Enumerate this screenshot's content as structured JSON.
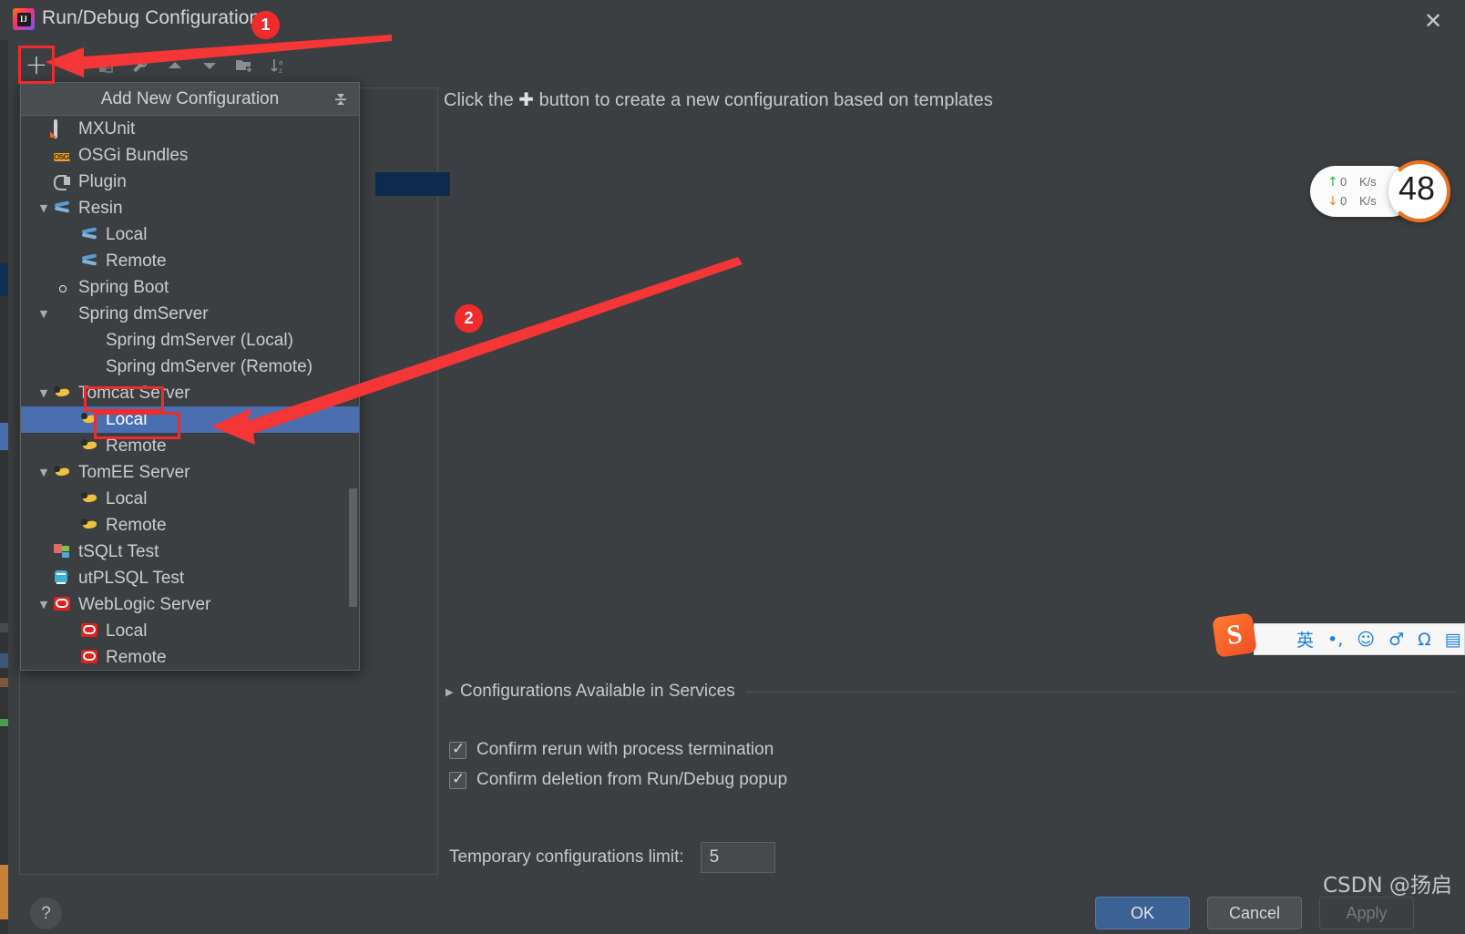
{
  "window": {
    "title": "Run/Debug Configurations",
    "app_icon": "intellij-idea-logo",
    "close_icon": "close-icon"
  },
  "toolbar": {
    "buttons": [
      {
        "name": "add-configuration-button",
        "icon": "plus-icon",
        "label": "+"
      },
      {
        "name": "remove-configuration-button",
        "icon": "minus-icon",
        "label": "−"
      },
      {
        "name": "copy-configuration-button",
        "icon": "copy-icon",
        "label": ""
      },
      {
        "name": "edit-templates-button",
        "icon": "wrench-icon",
        "label": ""
      },
      {
        "name": "move-up-button",
        "icon": "triangle-up-icon",
        "label": ""
      },
      {
        "name": "move-down-button",
        "icon": "triangle-down-icon",
        "label": ""
      },
      {
        "name": "new-folder-button",
        "icon": "folder-add-icon",
        "label": ""
      },
      {
        "name": "sort-button",
        "icon": "sort-az-icon",
        "label": ""
      }
    ]
  },
  "popup": {
    "title": "Add New Configuration",
    "collapse_icon": "collapse-all-icon",
    "items": [
      {
        "label": "MXUnit",
        "icon": "mxunit-icon",
        "indent": 0,
        "expandable": false,
        "selected": false
      },
      {
        "label": "OSGi Bundles",
        "icon": "osgi-icon",
        "indent": 0,
        "expandable": false,
        "selected": false
      },
      {
        "label": "Plugin",
        "icon": "plugin-icon",
        "indent": 0,
        "expandable": false,
        "selected": false
      },
      {
        "label": "Resin",
        "icon": "resin-icon",
        "indent": 0,
        "expandable": true,
        "selected": false
      },
      {
        "label": "Local",
        "icon": "resin-icon",
        "indent": 1,
        "expandable": false,
        "selected": false
      },
      {
        "label": "Remote",
        "icon": "resin-icon",
        "indent": 1,
        "expandable": false,
        "selected": false
      },
      {
        "label": "Spring Boot",
        "icon": "spring-boot-icon",
        "indent": 0,
        "expandable": false,
        "selected": false
      },
      {
        "label": "Spring dmServer",
        "icon": "spring-dm-icon",
        "indent": 0,
        "expandable": true,
        "selected": false
      },
      {
        "label": "Spring dmServer (Local)",
        "icon": "spring-dm-icon",
        "indent": 1,
        "expandable": false,
        "selected": false
      },
      {
        "label": "Spring dmServer (Remote)",
        "icon": "spring-dm-icon",
        "indent": 1,
        "expandable": false,
        "selected": false
      },
      {
        "label": "Tomcat Server",
        "icon": "tomcat-icon",
        "indent": 0,
        "expandable": true,
        "selected": false
      },
      {
        "label": "Local",
        "icon": "tomcat-icon",
        "indent": 1,
        "expandable": false,
        "selected": true
      },
      {
        "label": "Remote",
        "icon": "tomcat-icon",
        "indent": 1,
        "expandable": false,
        "selected": false
      },
      {
        "label": "TomEE Server",
        "icon": "tomcat-icon",
        "indent": 0,
        "expandable": true,
        "selected": false
      },
      {
        "label": "Local",
        "icon": "tomcat-icon",
        "indent": 1,
        "expandable": false,
        "selected": false
      },
      {
        "label": "Remote",
        "icon": "tomcat-icon",
        "indent": 1,
        "expandable": false,
        "selected": false
      },
      {
        "label": "tSQLt Test",
        "icon": "tsqlt-icon",
        "indent": 0,
        "expandable": false,
        "selected": false
      },
      {
        "label": "utPLSQL Test",
        "icon": "utplsql-icon",
        "indent": 0,
        "expandable": false,
        "selected": false
      },
      {
        "label": "WebLogic Server",
        "icon": "weblogic-icon",
        "indent": 0,
        "expandable": true,
        "selected": false
      },
      {
        "label": "Local",
        "icon": "weblogic-icon",
        "indent": 1,
        "expandable": false,
        "selected": false
      },
      {
        "label": "Remote",
        "icon": "weblogic-icon",
        "indent": 1,
        "expandable": false,
        "selected": false
      }
    ]
  },
  "main": {
    "hint_prefix": "Click the",
    "hint_plus": "✚",
    "hint_suffix": "button to create a new configuration based on templates",
    "services_section": "Configurations Available in Services",
    "checkboxes": [
      {
        "label": "Confirm rerun with process termination",
        "checked": true
      },
      {
        "label": "Confirm deletion from Run/Debug popup",
        "checked": true
      }
    ],
    "temporary_limit_label": "Temporary configurations limit:",
    "temporary_limit_value": "5"
  },
  "footer": {
    "help_label": "?",
    "ok_label": "OK",
    "cancel_label": "Cancel",
    "apply_label": "Apply"
  },
  "annotations": [
    {
      "name": "step-badge-1",
      "label": "1"
    },
    {
      "name": "step-badge-2",
      "label": "2"
    }
  ],
  "overlays": {
    "net_widget": {
      "upload_arrow": "↑",
      "upload_value": "0",
      "upload_unit": "K/s",
      "download_arrow": "↓",
      "download_value": "0",
      "download_unit": "K/s",
      "dial_value": "48"
    },
    "ime_bar": {
      "logo": "S",
      "items": [
        "英",
        "•,",
        "☺",
        "♂",
        "Ω",
        "▤"
      ]
    },
    "watermark": "CSDN @扬启"
  },
  "colors": {
    "accent_selection": "#4b6eaf",
    "annotation_red": "#f02b2b",
    "ok_button": "#3c6293",
    "dialog_bg": "#3c3f41"
  }
}
